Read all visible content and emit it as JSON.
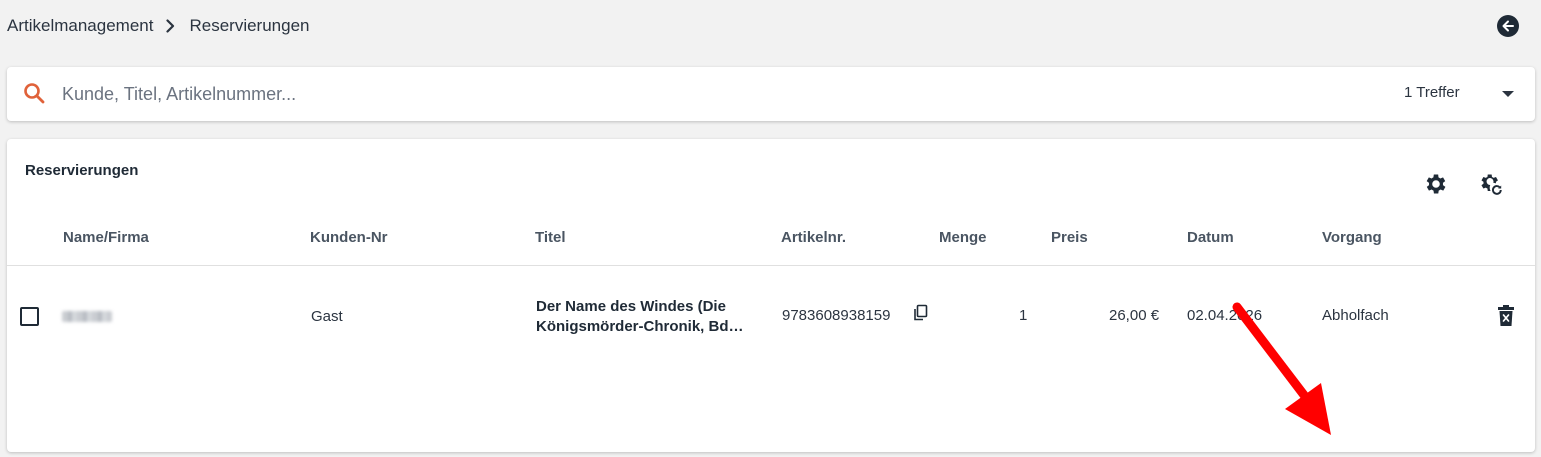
{
  "breadcrumb": {
    "items": [
      "Artikelmanagement",
      "Reservierungen"
    ]
  },
  "icons": {
    "back": "arrow-left-circle-icon",
    "search": "magnifier-icon",
    "dropdown": "caret-down-icon",
    "settings": "gear-icon",
    "settings_reset": "gear-refresh-icon",
    "copy": "copy-icon",
    "delete": "trash-icon"
  },
  "search": {
    "placeholder": "Kunde, Titel, Artikelnummer...",
    "value": "",
    "hits": "1 Treffer"
  },
  "table": {
    "title": "Reservierungen",
    "columns": [
      "Name/Firma",
      "Kunden-Nr",
      "Titel",
      "Artikelnr.",
      "Menge",
      "Preis",
      "Datum",
      "Vorgang"
    ],
    "rows": [
      {
        "name": "",
        "customer_no": "Gast",
        "title_line1": "Der Name des Windes (Die",
        "title_line2": "Königsmörder-Chronik, Bd…",
        "article_no": "9783608938159",
        "quantity": "1",
        "price": "26,00 €",
        "date": "02.04.2026",
        "process": "Abholfach"
      }
    ]
  },
  "colors": {
    "accent_search": "#e0623a",
    "annotation_arrow": "#ff0000",
    "dark": "#1f2a36"
  }
}
